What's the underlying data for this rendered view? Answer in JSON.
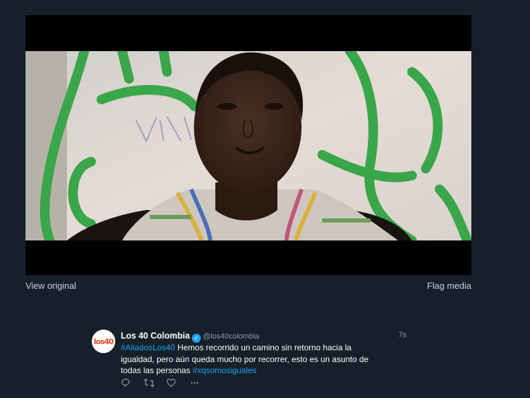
{
  "media": {
    "view_original": "View original",
    "flag_media": "Flag media"
  },
  "tweet": {
    "avatar_text": "los40",
    "display_name": "Los 40 Colombia",
    "handle": "@los40colombia",
    "timestamp": "7s",
    "hashtag_1": "#AliadosLos40",
    "text_line_1": " Hemos recorrido un camino sin retorno hacia la",
    "text_line_2": "igualdad, pero aún queda mucho por recorrer, esto es un asunto de",
    "text_line_3": "todas las personas ",
    "hashtag_2": "#xqsomosiguales"
  },
  "actions": {
    "reply_icon": "reply-icon",
    "retweet_icon": "retweet-icon",
    "like_icon": "like-icon",
    "more_icon": "more-icon"
  },
  "colors": {
    "background": "#15202b",
    "link": "#1da1f2",
    "muted": "#8899a6"
  }
}
